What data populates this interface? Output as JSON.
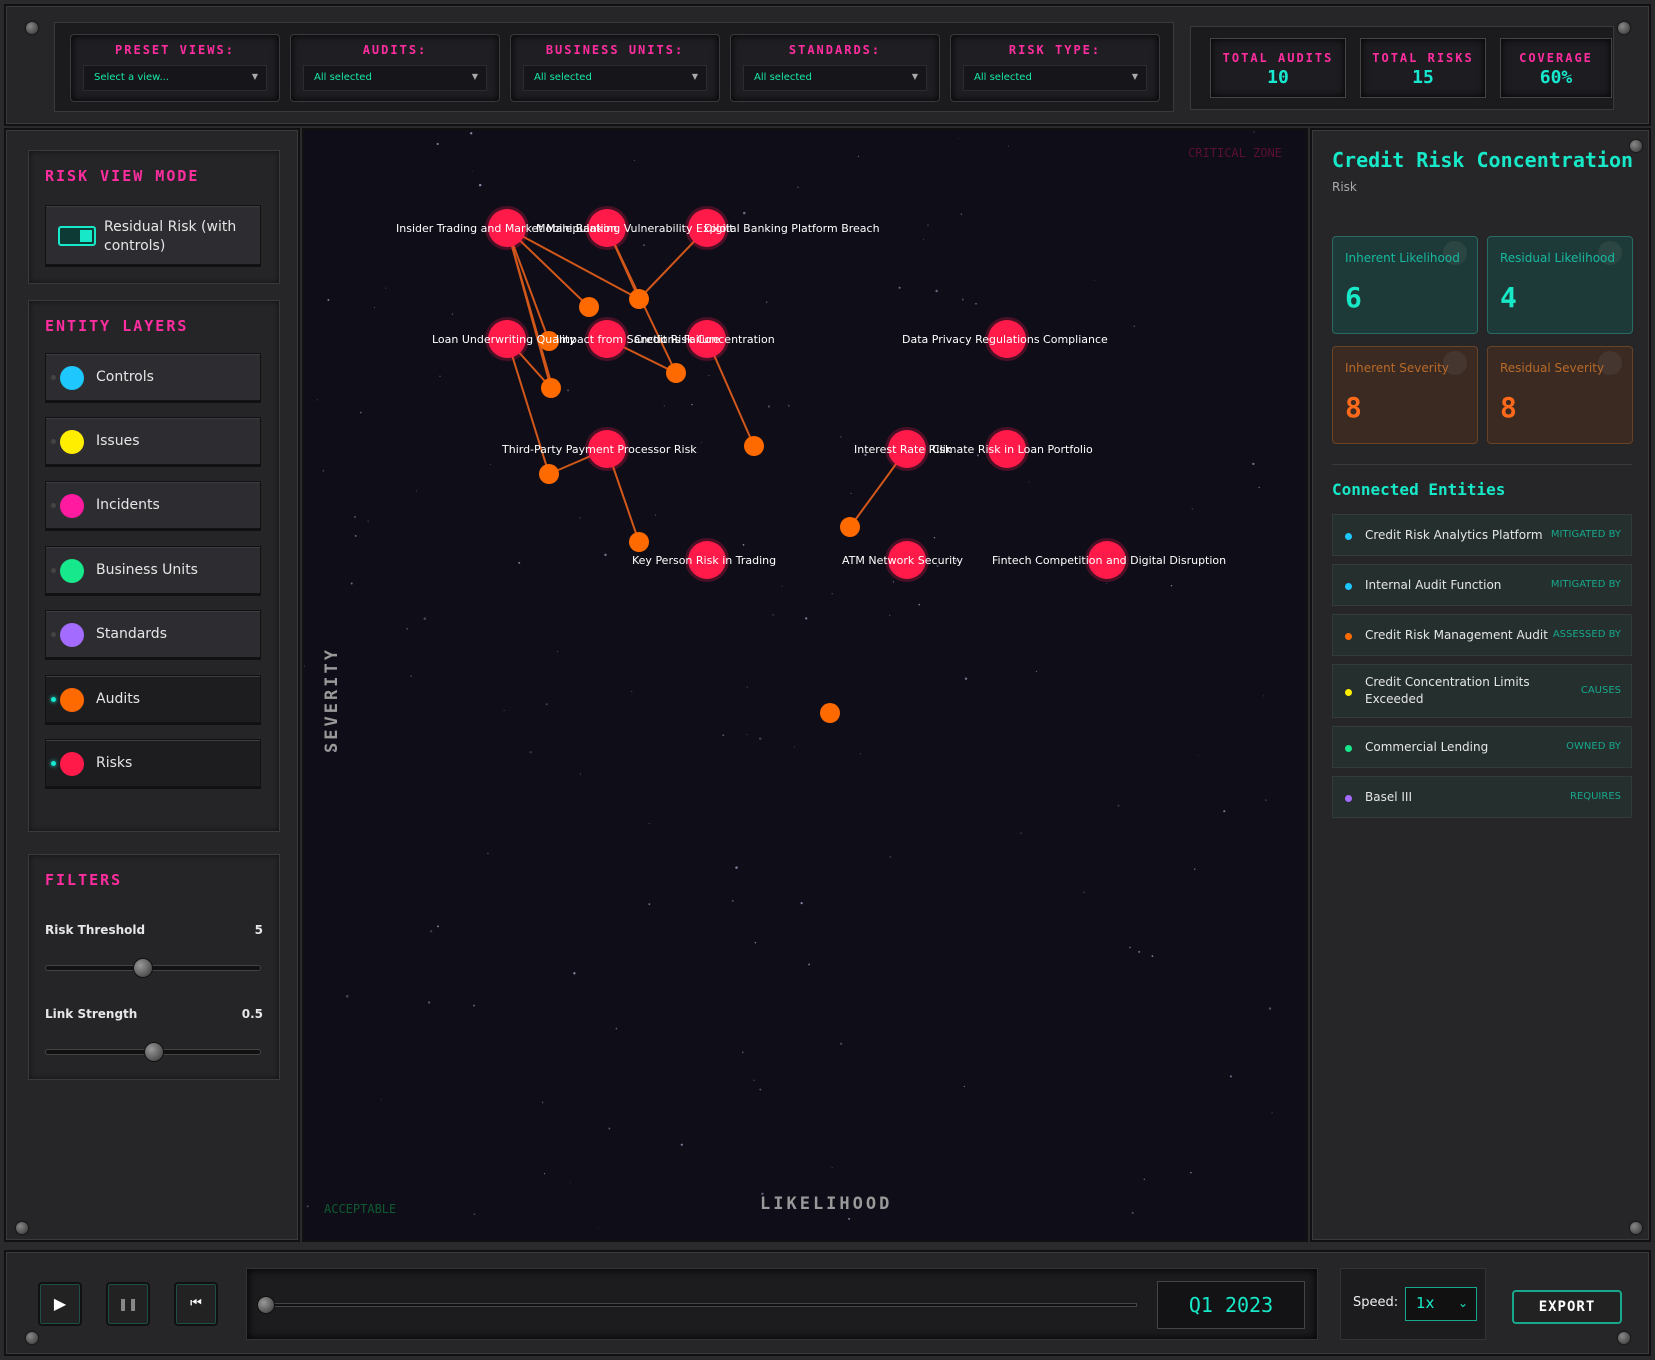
{
  "top": {
    "filters": [
      {
        "label": "PRESET VIEWS:",
        "value": "Select a view..."
      },
      {
        "label": "AUDITS:",
        "value": "All selected"
      },
      {
        "label": "BUSINESS UNITS:",
        "value": "All selected"
      },
      {
        "label": "STANDARDS:",
        "value": "All selected"
      },
      {
        "label": "RISK TYPE:",
        "value": "All selected"
      }
    ],
    "stats": [
      {
        "label": "TOTAL AUDITS",
        "value": "10"
      },
      {
        "label": "TOTAL RISKS",
        "value": "15"
      },
      {
        "label": "COVERAGE",
        "value": "60%"
      }
    ]
  },
  "left": {
    "view_mode_title": "RISK VIEW MODE",
    "view_mode_toggle": "Residual Risk (with controls)",
    "layers_title": "ENTITY LAYERS",
    "layers": [
      {
        "label": "Controls",
        "color": "#1ec8ff",
        "active": false
      },
      {
        "label": "Issues",
        "color": "#ffee00",
        "active": false
      },
      {
        "label": "Incidents",
        "color": "#ff1aa0",
        "active": false
      },
      {
        "label": "Business Units",
        "color": "#17e88c",
        "active": false
      },
      {
        "label": "Standards",
        "color": "#a36bff",
        "active": false
      },
      {
        "label": "Audits",
        "color": "#ff6a00",
        "active": true
      },
      {
        "label": "Risks",
        "color": "#ff1a4a",
        "active": true
      }
    ],
    "filters_title": "FILTERS",
    "risk_threshold_label": "Risk Threshold",
    "risk_threshold_value": "5",
    "risk_threshold_level": 0.45,
    "link_strength_label": "Link Strength",
    "link_strength_value": "0.5",
    "link_strength_level": 0.5
  },
  "graph": {
    "y_axis": "SEVERITY",
    "x_axis": "LIKELIHOOD",
    "critical_zone": "CRITICAL ZONE",
    "acceptable": "ACCEPTABLE",
    "risk_color": "#ff1a4a",
    "audit_color": "#ff6a00",
    "risks": [
      {
        "id": "r1",
        "label": "Insider Trading and Market Manipulation"
      },
      {
        "id": "r2",
        "label": "Mobile Banking Vulnerability Exploit"
      },
      {
        "id": "r3",
        "label": "Digital Banking Platform Breach"
      },
      {
        "id": "r4",
        "label": "Loan Underwriting Quality"
      },
      {
        "id": "r5",
        "label": "Impact from Sanctions Failure"
      },
      {
        "id": "r6",
        "label": "Credit Risk Concentration"
      },
      {
        "id": "r7",
        "label": "Data Privacy Regulations Compliance"
      },
      {
        "id": "r8",
        "label": "Third-Party Payment Processor Risk"
      },
      {
        "id": "r9",
        "label": "Interest Rate Risk"
      },
      {
        "id": "r10",
        "label": "Climate Risk in Loan Portfolio"
      },
      {
        "id": "r11",
        "label": "Key Person Risk in Trading"
      },
      {
        "id": "r12",
        "label": "ATM Network Security"
      },
      {
        "id": "r13",
        "label": "Fintech Competition and Digital Disruption"
      }
    ],
    "audits": [
      {
        "id": "a1"
      },
      {
        "id": "a2"
      },
      {
        "id": "a3"
      },
      {
        "id": "a4"
      },
      {
        "id": "a5"
      },
      {
        "id": "a6"
      },
      {
        "id": "a7"
      },
      {
        "id": "a8"
      },
      {
        "id": "a9"
      },
      {
        "id": "a10"
      }
    ],
    "links": [
      [
        "r1",
        "a2"
      ],
      [
        "r1",
        "a1"
      ],
      [
        "r1",
        "a3"
      ],
      [
        "r1",
        "a8"
      ],
      [
        "r2",
        "a5"
      ],
      [
        "r3",
        "a2"
      ],
      [
        "r6",
        "a6"
      ],
      [
        "r4",
        "a8"
      ],
      [
        "r8",
        "a7"
      ],
      [
        "r9",
        "a9"
      ]
    ]
  },
  "detail": {
    "title": "Credit Risk Concentration",
    "subtitle": "Risk",
    "metrics": [
      {
        "label": "Inherent Likelihood",
        "value": "6",
        "tone": "teal"
      },
      {
        "label": "Residual Likelihood",
        "value": "4",
        "tone": "teal"
      },
      {
        "label": "Inherent Severity",
        "value": "8",
        "tone": "orange"
      },
      {
        "label": "Residual Severity",
        "value": "8",
        "tone": "orange"
      }
    ],
    "connected_title": "Connected Entities",
    "entities": [
      {
        "name": "Credit Risk Analytics Platform",
        "rel": "MITIGATED BY",
        "color": "#1ec8ff"
      },
      {
        "name": "Internal Audit Function",
        "rel": "MITIGATED BY",
        "color": "#1ec8ff"
      },
      {
        "name": "Credit Risk Management Audit",
        "rel": "ASSESSED BY",
        "color": "#ff6a00"
      },
      {
        "name": "Credit Concentration Limits Exceeded",
        "rel": "CAUSES",
        "color": "#ffee00"
      },
      {
        "name": "Commercial Lending",
        "rel": "OWNED BY",
        "color": "#17e88c"
      },
      {
        "name": "Basel III",
        "rel": "REQUIRES",
        "color": "#a36bff"
      }
    ]
  },
  "bottom": {
    "play_icon": "play-icon",
    "pause_icon": "pause-icon",
    "rewind_icon": "rewind-icon",
    "date": "Q1 2023",
    "timeline_progress": 0,
    "speed_label": "Speed:",
    "speed_value": "1x",
    "export_label": "EXPORT"
  }
}
